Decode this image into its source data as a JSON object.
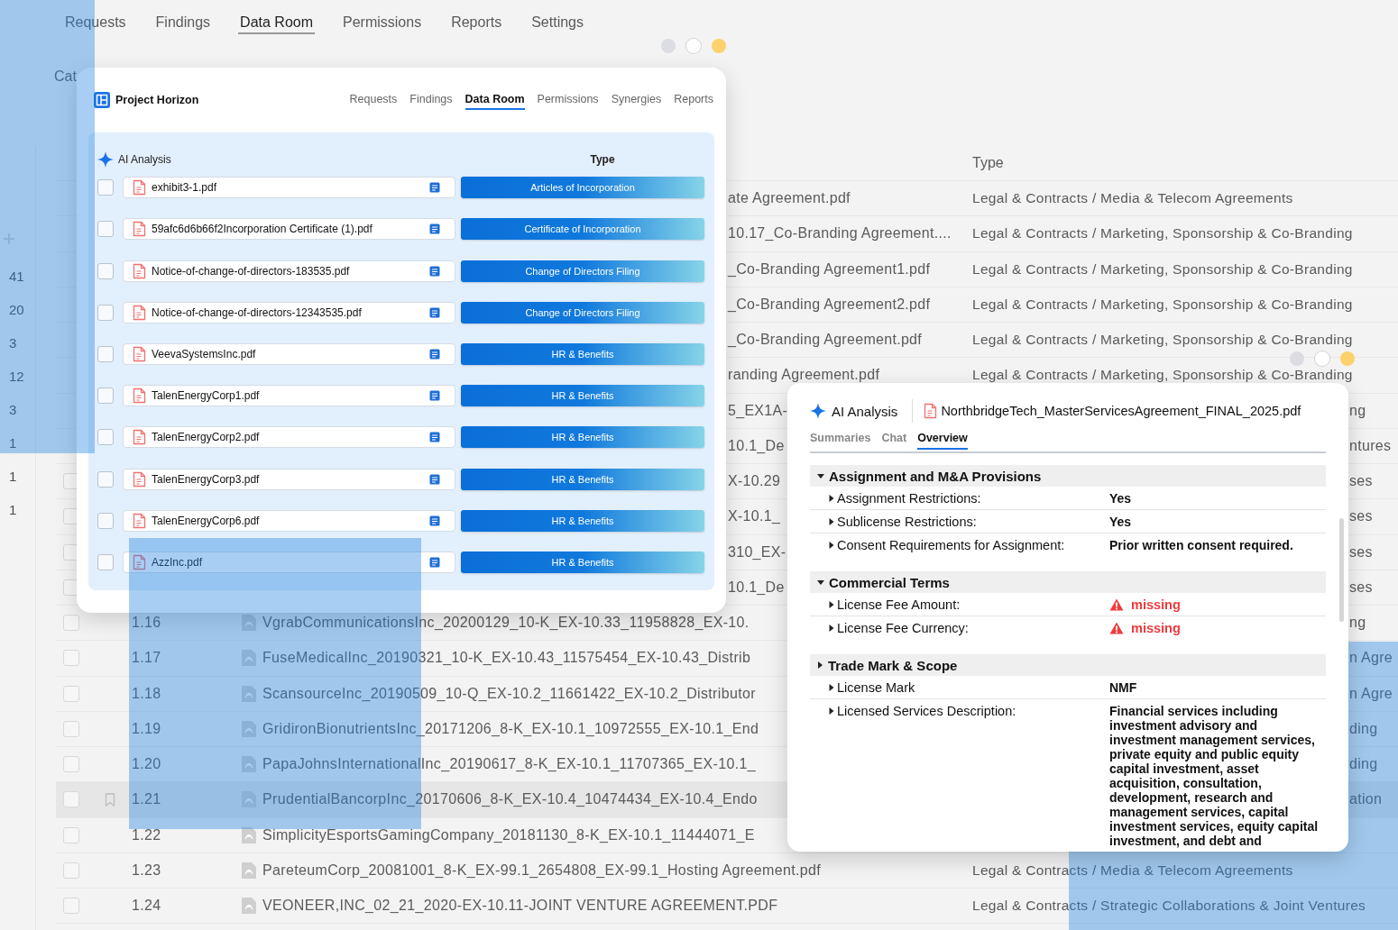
{
  "background_app": {
    "tabs": [
      {
        "label": "Requests",
        "selected": false
      },
      {
        "label": "Findings",
        "selected": false
      },
      {
        "label": "Data Room",
        "selected": true
      },
      {
        "label": "Permissions",
        "selected": false
      },
      {
        "label": "Reports",
        "selected": false
      },
      {
        "label": "Settings",
        "selected": false
      }
    ],
    "section_label": "Cat",
    "sidebar_counts": [
      "41",
      "20",
      "3",
      "12",
      "3",
      "1",
      "1",
      "1"
    ],
    "type_header": "Type",
    "rows": [
      {
        "name_tail": "ate Agreement.pdf",
        "type": "Legal & Contracts / Media & Telecom Agreements"
      },
      {
        "name_tail": "10.17_Co-Branding Agreement....",
        "type": "Legal & Contracts / Marketing, Sponsorship & Co-Branding"
      },
      {
        "name_tail": "_Co-Branding Agreement1.pdf",
        "type": "Legal & Contracts / Marketing, Sponsorship & Co-Branding"
      },
      {
        "name_tail": "_Co-Branding Agreement2.pdf",
        "type": "Legal & Contracts / Marketing, Sponsorship & Co-Branding"
      },
      {
        "name_tail": "_Co-Branding Agreement.pdf",
        "type": "Legal & Contracts / Marketing, Sponsorship & Co-Branding"
      },
      {
        "name_tail": "randing Agreement.pdf",
        "type": "Legal & Contracts / Marketing, Sponsorship & Co-Branding"
      },
      {
        "name_tail": "5_EX1A-",
        "type_tail": "ng"
      },
      {
        "name_tail": "10.1_De",
        "type_tail": "ntures"
      },
      {
        "checked": false,
        "name_tail": "X-10.29",
        "type_tail": "ses"
      },
      {
        "checked": false,
        "name_tail": "X-10.1_",
        "type_tail": "ses"
      },
      {
        "checked": false,
        "name_tail": "310_EX-",
        "type_tail": "ses"
      },
      {
        "checked": false,
        "name_tail": "10.1_De",
        "type_tail": "ses"
      },
      {
        "checked": false,
        "selected": false,
        "number": "1.16",
        "name": "VgrabCommunicationsInc_20200129_10-K_EX-10.33_11958828_EX-10.",
        "type_tail": "ng"
      },
      {
        "checked": false,
        "selected": false,
        "number": "1.17",
        "name": "FuseMedicalInc_20190321_10-K_EX-10.43_11575454_EX-10.43_Distrib",
        "type_tail": "n Agre"
      },
      {
        "checked": false,
        "selected": false,
        "number": "1.18",
        "name": "ScansourceInc_20190509_10-Q_EX-10.2_11661422_EX-10.2_Distributor",
        "type_tail": "n Agre"
      },
      {
        "checked": false,
        "selected": false,
        "number": "1.19",
        "name": "GridironBionutrientsInc_20171206_8-K_EX-10.1_10972555_EX-10.1_End",
        "type_tail": "ding"
      },
      {
        "checked": false,
        "selected": false,
        "number": "1.20",
        "name": "PapaJohnsInternationalInc_20190617_8-K_EX-10.1_11707365_EX-10.1_",
        "type_tail": "ding"
      },
      {
        "checked": false,
        "selected": true,
        "number": "1.21",
        "name": "PrudentialBancorpInc_20170606_8-K_EX-10.4_10474434_EX-10.4_Endo",
        "type_tail": "ation"
      },
      {
        "checked": false,
        "selected": false,
        "number": "1.22",
        "name": "SimplicityEsportsGamingCompany_20181130_8-K_EX-10.1_11444071_E"
      },
      {
        "checked": false,
        "selected": false,
        "number": "1.23",
        "name": "PareteumCorp_20081001_8-K_EX-99.1_2654808_EX-99.1_Hosting Agreement.pdf",
        "type": "Legal & Contracts / Media & Telecom Agreements"
      },
      {
        "checked": false,
        "selected": false,
        "number": "1.24",
        "name": "VEONEER,INC_02_21_2020-EX-10.11-JOINT VENTURE AGREEMENT.PDF",
        "type": "Legal & Contracts / Strategic Collaborations & Joint Ventures"
      }
    ]
  },
  "data_room_window": {
    "project": "Project Horizon",
    "nav": [
      {
        "label": "Requests",
        "selected": false
      },
      {
        "label": "Findings",
        "selected": false
      },
      {
        "label": "Data Room",
        "selected": true
      },
      {
        "label": "Permissions",
        "selected": false
      },
      {
        "label": "Synergies",
        "selected": false
      },
      {
        "label": "Reports",
        "selected": false
      }
    ],
    "panel_title": "AI Analysis",
    "type_header": "Type",
    "files": [
      {
        "name": "exhibit3-1.pdf",
        "type": "Articles of Incorporation",
        "checked": false
      },
      {
        "name": "59afc6d6b66f2Incorporation Certificate (1).pdf",
        "type": "Certificate of Incorporation",
        "checked": false
      },
      {
        "name": "Notice-of-change-of-directors-183535.pdf",
        "type": "Change of Directors Filing",
        "checked": false
      },
      {
        "name": "Notice-of-change-of-directors-12343535.pdf",
        "type": "Change of Directors Filing",
        "checked": false
      },
      {
        "name": "VeevaSystemsInc.pdf",
        "type": "HR & Benefits",
        "checked": false
      },
      {
        "name": "TalenEnergyCorp1.pdf",
        "type": "HR & Benefits",
        "checked": false
      },
      {
        "name": "TalenEnergyCorp2.pdf",
        "type": "HR & Benefits",
        "checked": false
      },
      {
        "name": "TalenEnergyCorp3.pdf",
        "type": "HR & Benefits",
        "checked": false
      },
      {
        "name": "TalenEnergyCorp6.pdf",
        "type": "HR & Benefits",
        "checked": false
      },
      {
        "name": "AzzInc.pdf",
        "type": "HR & Benefits",
        "checked": false
      }
    ]
  },
  "analysis_window": {
    "title": "AI Analysis",
    "file": "NorthbridgeTech_MasterServicesAgreement_FINAL_2025.pdf",
    "tabs": [
      {
        "label": "Summaries",
        "selected": false
      },
      {
        "label": "Chat",
        "selected": false
      },
      {
        "label": "Overview",
        "selected": true
      }
    ],
    "sections": [
      {
        "title": "Assignment and M&A Provisions",
        "expanded": true,
        "items": [
          {
            "label": "Assignment Restrictions:",
            "value": "Yes",
            "kind": "text"
          },
          {
            "label": "Sublicense Restrictions:",
            "value": "Yes",
            "kind": "text"
          },
          {
            "label": "Consent Requirements for Assignment:",
            "value": "Prior written consent required.",
            "kind": "text"
          }
        ]
      },
      {
        "title": "Commercial Terms",
        "expanded": true,
        "items": [
          {
            "label": "License Fee Amount:",
            "value": "missing",
            "kind": "warning"
          },
          {
            "label": "License Fee Currency:",
            "value": "missing",
            "kind": "warning"
          }
        ]
      },
      {
        "title": "Trade Mark & Scope",
        "expanded": false,
        "items": [
          {
            "label": "License Mark",
            "value": "NMF",
            "kind": "text"
          },
          {
            "label": "Licensed Services Description:",
            "value": "Financial services including investment advisory and investment management services, private equity and public equity capital investment, asset acquisition, consultation, development, research and management services, capital investment services, equity capital investment, and debt and",
            "kind": "text"
          }
        ]
      }
    ]
  }
}
